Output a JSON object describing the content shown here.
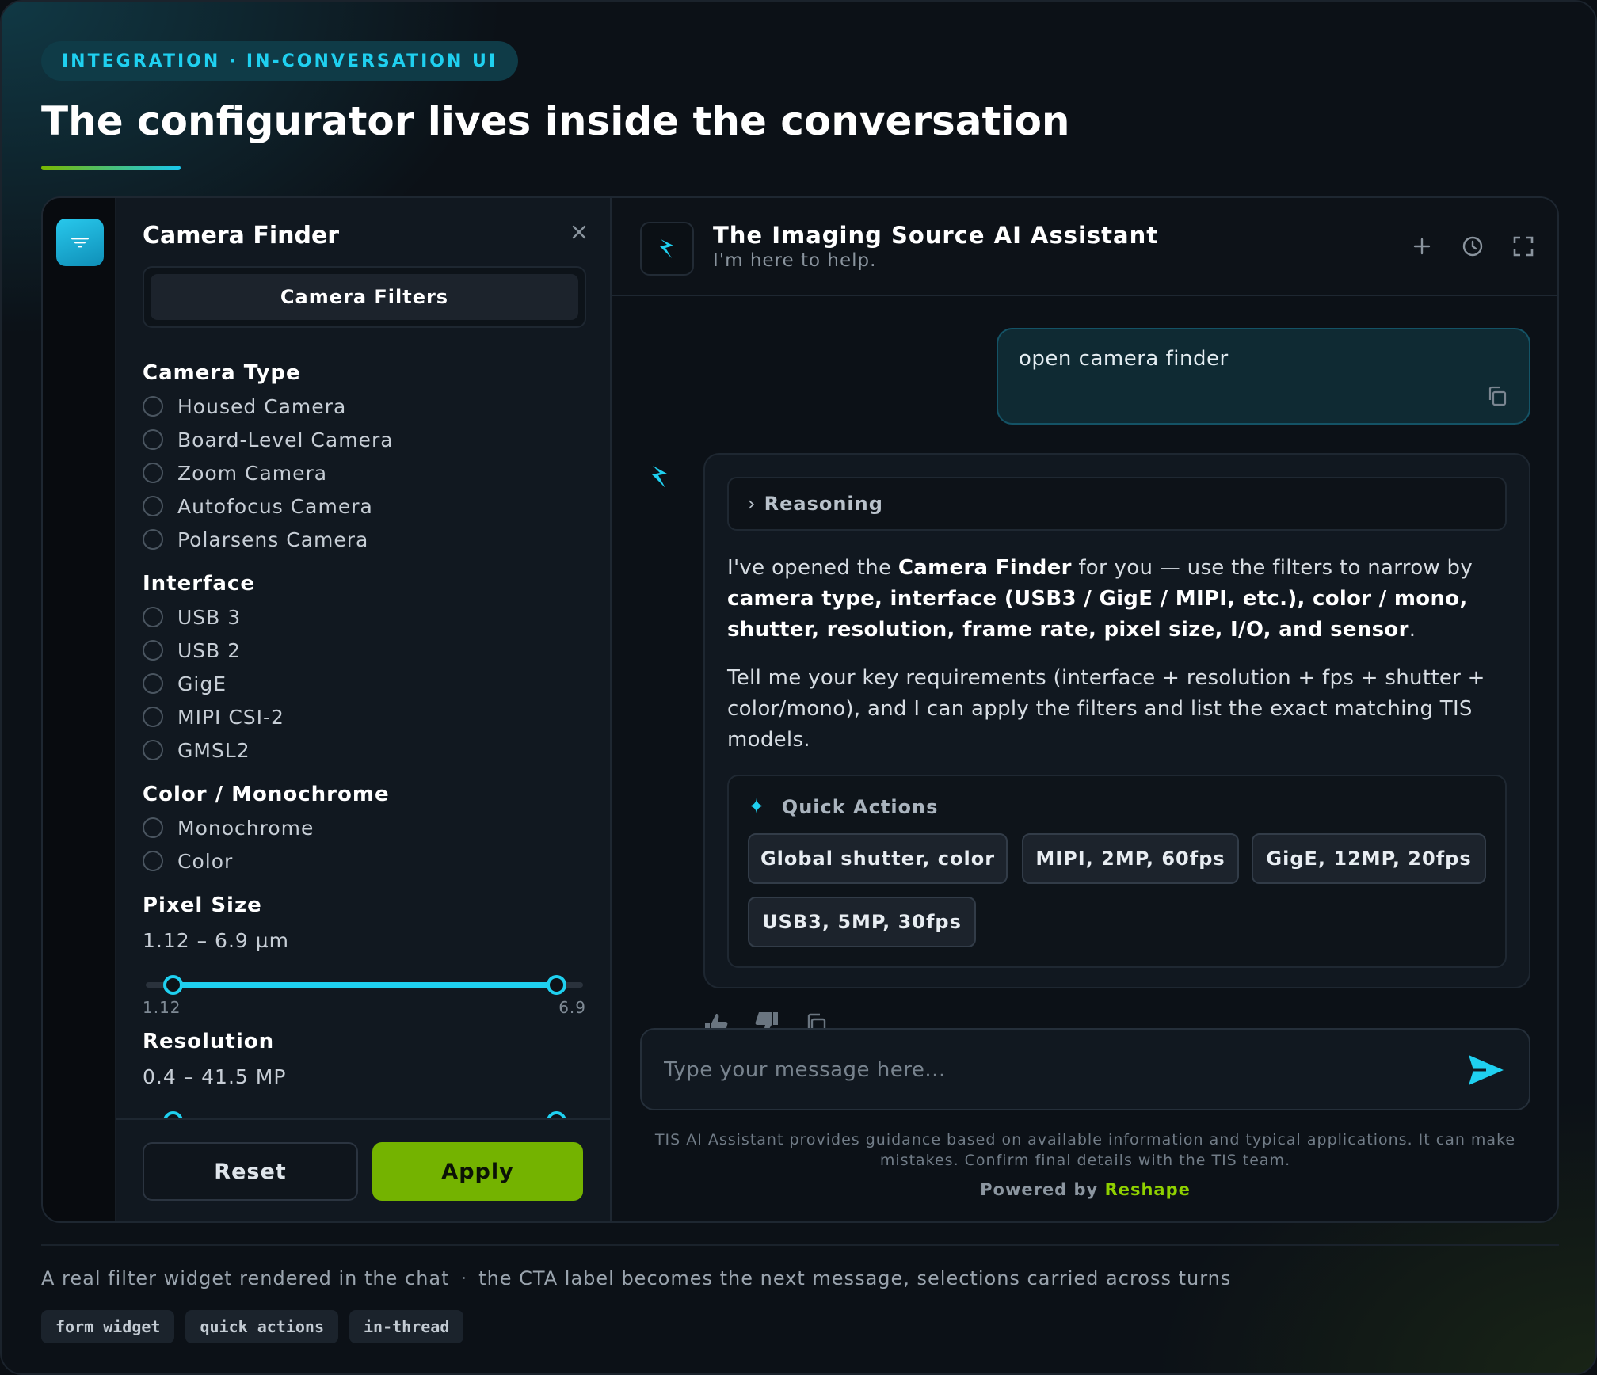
{
  "eyebrow": "INTEGRATION · IN-CONVERSATION UI",
  "headline": "The configurator lives inside the conversation",
  "colors": {
    "accent": "#1fd0f0",
    "apply": "#74b300",
    "brand": "#8fd100"
  },
  "rail": {
    "icon": "filter-icon"
  },
  "finder": {
    "title": "Camera Finder",
    "close_icon": "close-icon",
    "tab_label": "Camera Filters",
    "sections": [
      {
        "title": "Camera Type",
        "options": [
          "Housed Camera",
          "Board-Level Camera",
          "Zoom Camera",
          "Autofocus Camera",
          "Polarsens Camera"
        ]
      },
      {
        "title": "Interface",
        "options": [
          "USB 3",
          "USB 2",
          "GigE",
          "MIPI CSI-2",
          "GMSL2"
        ]
      },
      {
        "title": "Color / Monochrome",
        "options": [
          "Monochrome",
          "Color"
        ]
      }
    ],
    "pixel_size": {
      "title": "Pixel Size",
      "range_text": "1.12 – 6.9 µm",
      "min_label": "1.12",
      "max_label": "6.9",
      "value": [
        1.12,
        6.9
      ]
    },
    "resolution": {
      "title": "Resolution",
      "range_text": "0.4 – 41.5 MP",
      "value": [
        0.4,
        41.5
      ]
    },
    "reset_label": "Reset",
    "apply_label": "Apply"
  },
  "chat": {
    "title": "The Imaging Source AI Assistant",
    "subtitle": "I'm here to help.",
    "header_icons": [
      "plus-icon",
      "history-icon",
      "expand-icon"
    ],
    "user_message": "open camera finder",
    "reasoning_label": "Reasoning",
    "bot": {
      "p1_a": "I've opened the ",
      "p1_b": "Camera Finder",
      "p1_c": " for you — use the filters to narrow by ",
      "p1_d": "camera type, interface (USB3 / GigE / MIPI, etc.), color / mono, shutter, resolution, frame rate, pixel size, I/O, and sensor",
      "p1_e": ".",
      "p2": "Tell me your key requirements (interface + resolution + fps + shutter + color/mono), and I can apply the filters and list the exact matching TIS models."
    },
    "quick_actions_label": "Quick Actions",
    "quick_actions": [
      "Global shutter, color",
      "MIPI, 2MP, 60fps",
      "GigE, 12MP, 20fps",
      "USB3, 5MP, 30fps"
    ],
    "input_placeholder": "Type your message here...",
    "disclaimer": "TIS AI Assistant provides guidance based on available information and typical applications. It can make mistakes. Confirm final details with the TIS team.",
    "powered_by": "Powered by",
    "powered_brand": "Reshape"
  },
  "caption": {
    "left": "A real filter widget rendered in the chat",
    "right": "the CTA label becomes the next message, selections carried across turns"
  },
  "tags": [
    "form widget",
    "quick actions",
    "in-thread"
  ]
}
